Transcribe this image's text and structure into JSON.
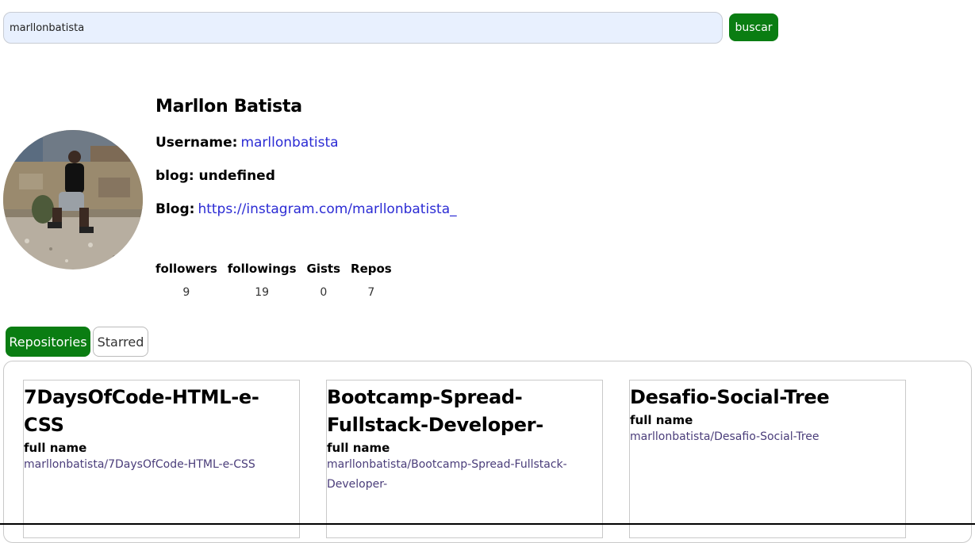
{
  "search": {
    "value": "marllonbatista",
    "button_label": "buscar"
  },
  "profile": {
    "name": "Marllon Batista",
    "username_label": "Username:",
    "username": "marllonbatista",
    "blog_label_1": "blog: undefined",
    "blog_label_2": "Blog:",
    "blog_url": "https://instagram.com/marllonbatista_"
  },
  "stats": [
    {
      "label": "followers",
      "value": "9"
    },
    {
      "label": "followings",
      "value": "19"
    },
    {
      "label": "Gists",
      "value": "0"
    },
    {
      "label": "Repos",
      "value": "7"
    }
  ],
  "tabs": [
    {
      "label": "Repositories",
      "active": true
    },
    {
      "label": "Starred",
      "active": false
    }
  ],
  "repos": [
    {
      "name": "7DaysOfCode-HTML-e-CSS",
      "sub_label": "full name",
      "full_name": "marllonbatista/7DaysOfCode-HTML-e-CSS"
    },
    {
      "name": "Bootcamp-Spread-Fullstack-Developer-",
      "sub_label": "full name",
      "full_name": "marllonbatista/Bootcamp-Spread-Fullstack-Developer-"
    },
    {
      "name": "Desafio-Social-Tree",
      "sub_label": "full name",
      "full_name": "marllonbatista/Desafio-Social-Tree"
    }
  ],
  "colors": {
    "accent": "#0a7d12",
    "link": "#2b2bd4",
    "input_bg": "#e8f0fe"
  }
}
